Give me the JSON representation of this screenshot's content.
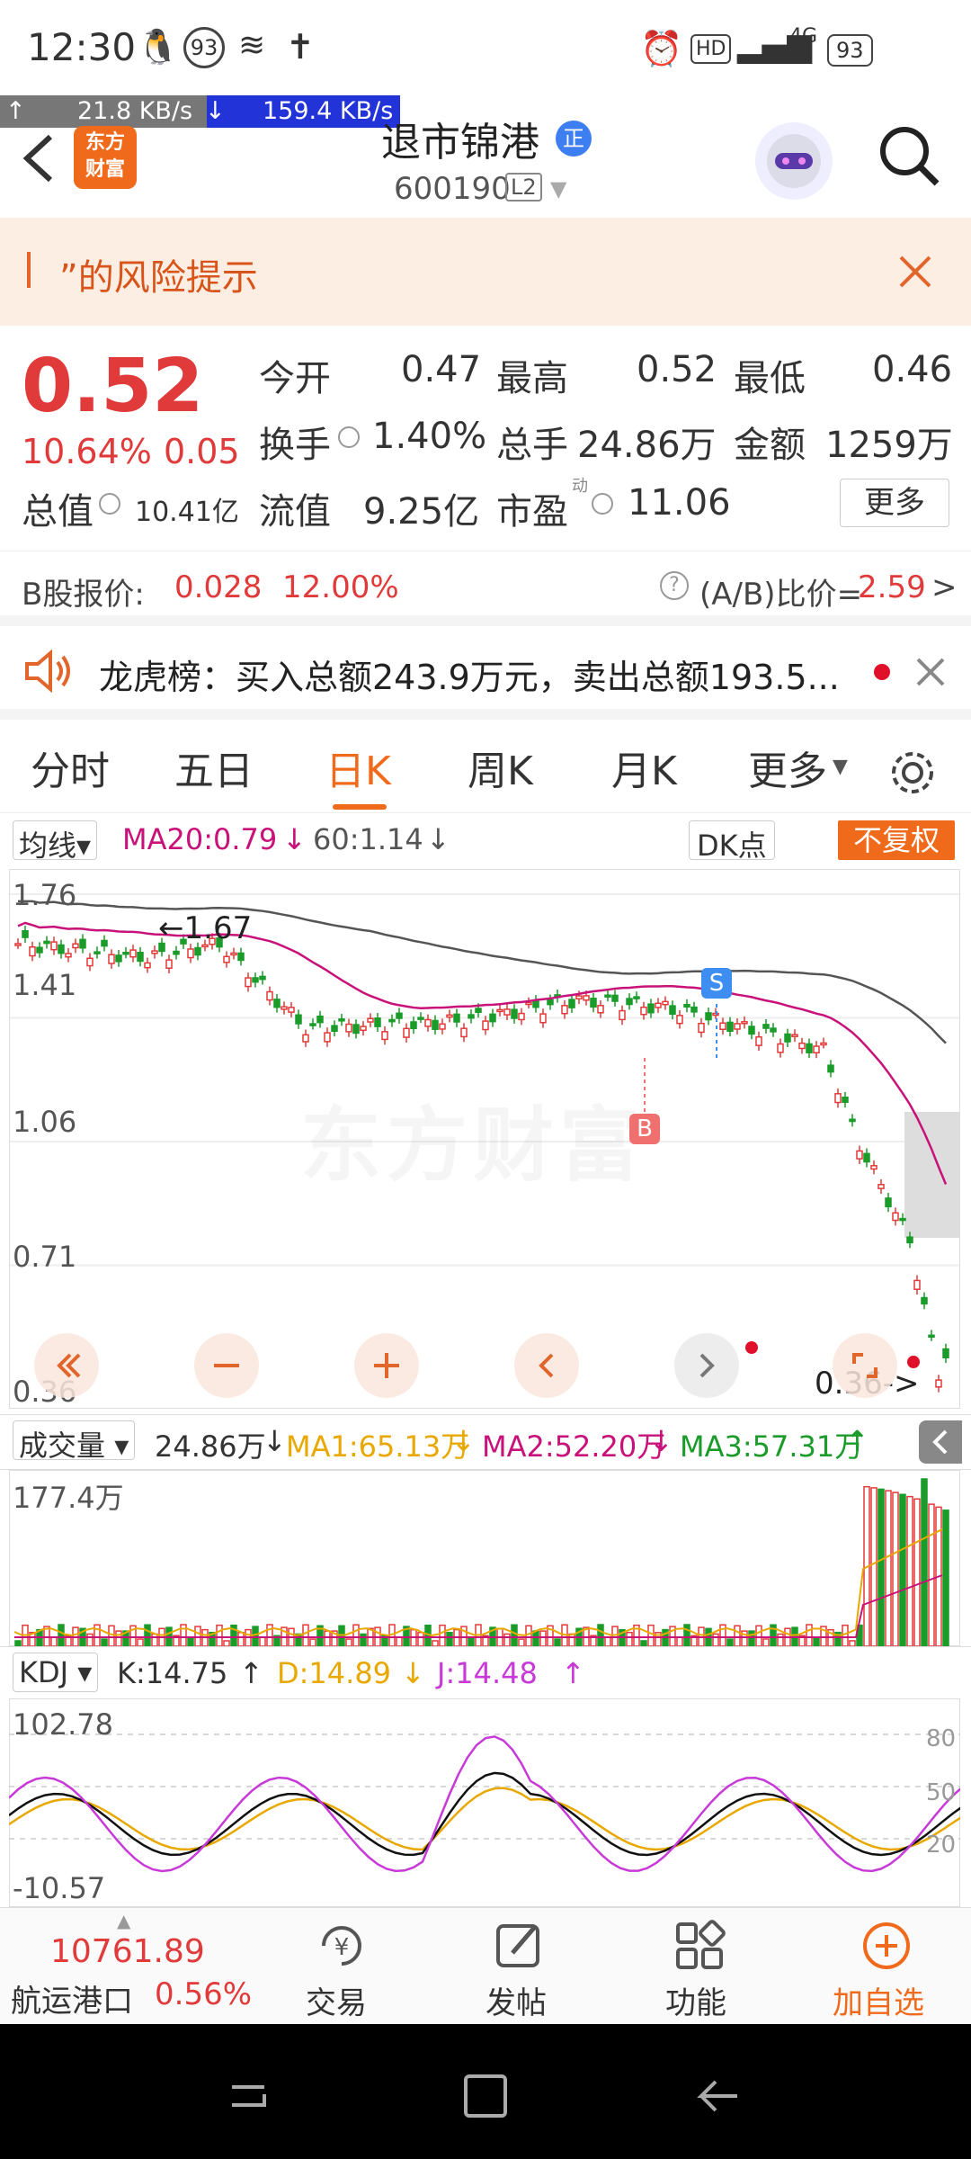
{
  "status": {
    "time": "12:30",
    "notif_count": "93",
    "battery": "93",
    "hd": "HD",
    "net": "4G"
  },
  "netspeed": {
    "up": "↑",
    "up_val": "21.8 KB/s",
    "down": "↓",
    "down_val": "159.4 KB/s"
  },
  "header": {
    "logo_line1": "东方",
    "logo_line2": "财富",
    "stock_name": "退市锦港",
    "badge": "正",
    "code": "600190",
    "level": "L2"
  },
  "risk": {
    "text": "”的风险提示"
  },
  "quote": {
    "price": "0.52",
    "change_pct": "10.64%",
    "change_abs": "0.05",
    "rows": [
      [
        {
          "l": "今开",
          "v": "0.47",
          "c": "#333"
        },
        {
          "l": "最高",
          "v": "0.52",
          "c": "#e03a3a"
        },
        {
          "l": "最低",
          "v": "0.46",
          "c": "#1a9b2a"
        }
      ],
      [
        {
          "l": "换手",
          "v": "1.40%",
          "c": "#333"
        },
        {
          "l": "总手",
          "v": "24.86万",
          "c": "#333"
        },
        {
          "l": "金额",
          "v": "1259万",
          "c": "#333"
        }
      ]
    ],
    "total_val_label": "总值",
    "total_val": "10.41亿",
    "float_label": "流值",
    "float_val": "9.25亿",
    "pe_label": "市盈",
    "pe_sup": "动",
    "pe_val": "11.06",
    "more": "更多"
  },
  "bshare": {
    "label": "B股报价:",
    "price": "0.028",
    "pct": "12.00%",
    "ratio_label": "(A/B)比价=",
    "ratio": "2.59"
  },
  "dragon": {
    "text": "龙虎榜：买入总额243.9万元，卖出总额193.5..."
  },
  "tabs": [
    "分时",
    "五日",
    "日K",
    "周K",
    "月K",
    "更多"
  ],
  "active_tab": 2,
  "chart_head": {
    "ma_select": "均线",
    "ma20": "MA20:0.79",
    "ma60": "60:1.14",
    "dk": "DK点",
    "fq": "不复权"
  },
  "chart_data": {
    "type": "candlestick",
    "y_ticks": [
      "1.76",
      "1.41",
      "1.06",
      "0.71",
      "0.36"
    ],
    "high_label": "1.67",
    "low_label": "0.36",
    "markers": [
      "S",
      "B"
    ],
    "watermark": "东方财富"
  },
  "volume": {
    "select": "成交量",
    "val": "24.86万",
    "ma1": "MA1:65.13万",
    "ma2": "MA2:52.20万",
    "ma3": "MA3:57.31万",
    "max": "177.4万"
  },
  "kdj": {
    "select": "KDJ",
    "k": "K:14.75",
    "d": "D:14.89",
    "j": "J:14.48",
    "max": "102.78",
    "min": "-10.57",
    "r80": "80",
    "r50": "50",
    "r20": "20"
  },
  "bottom": {
    "index_val": "10761.89",
    "index_name": "航运港口",
    "index_pct": "0.56%",
    "trade": "交易",
    "post": "发帖",
    "func": "功能",
    "add": "加自选"
  },
  "colors": {
    "up": "#e03a3a",
    "down": "#1a9b2a",
    "accent": "#f06a1c",
    "ma20": "#c8127a",
    "ma60": "#555555"
  }
}
